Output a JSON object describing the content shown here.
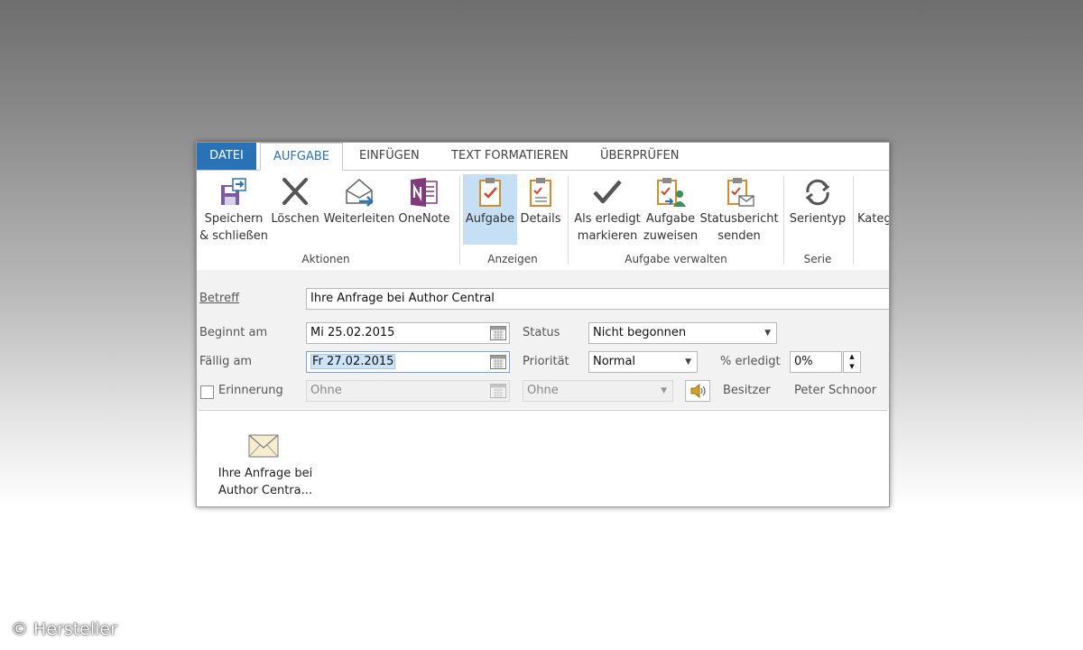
{
  "tabs": [
    {
      "label": "DATEI"
    },
    {
      "label": "AUFGABE"
    },
    {
      "label": "EINFÜGEN"
    },
    {
      "label": "TEXT FORMATIEREN"
    },
    {
      "label": "ÜBERPRÜFEN"
    }
  ],
  "ribbon": {
    "buttons": {
      "save_close": {
        "line1": "Speichern",
        "line2": "& schließen",
        "icon": "save-close-icon"
      },
      "delete": {
        "line1": "Löschen",
        "icon": "delete-x-icon"
      },
      "forward": {
        "line1": "Weiterleiten",
        "icon": "forward-mail-icon"
      },
      "onenote": {
        "line1": "OneNote",
        "icon": "onenote-icon"
      },
      "task": {
        "line1": "Aufgabe",
        "icon": "task-clipboard-icon"
      },
      "details": {
        "line1": "Details",
        "icon": "details-clipboard-icon"
      },
      "mark_done": {
        "line1": "Als erledigt",
        "line2": "markieren",
        "icon": "checkmark-icon"
      },
      "assign": {
        "line1": "Aufgabe",
        "line2": "zuweisen",
        "icon": "assign-task-icon"
      },
      "status_report": {
        "line1": "Statusbericht",
        "line2": "senden",
        "icon": "status-report-icon"
      },
      "recurrence": {
        "line1": "Serientyp",
        "icon": "recurrence-icon"
      },
      "categorize": {
        "line1": "Kateg"
      }
    },
    "groups": {
      "actions": "Aktionen",
      "show": "Anzeigen",
      "manage": "Aufgabe verwalten",
      "series": "Serie"
    }
  },
  "form": {
    "subject_label": "Betreff",
    "subject_value": "Ihre Anfrage bei Author Central",
    "start_label": "Beginnt am",
    "start_value": "Mi 25.02.2015",
    "due_label": "Fällig am",
    "due_value": "Fr 27.02.2015",
    "reminder_label": "Erinnerung",
    "reminder_checked": false,
    "reminder_date": "Ohne",
    "reminder_time": "Ohne",
    "status_label": "Status",
    "status_value": "Nicht begonnen",
    "priority_label": "Priorität",
    "priority_value": "Normal",
    "percent_label": "% erledigt",
    "percent_value": "0%",
    "owner_label": "Besitzer",
    "owner_value": "Peter Schnoor"
  },
  "attachment": {
    "line1": "Ihre Anfrage bei",
    "line2": "Author Centra...",
    "icon": "envelope-icon"
  },
  "watermark": "© Hersteller",
  "colors": {
    "file_tab": "#2a72b8",
    "selected_button": "#c5dff5",
    "onenote_purple": "#80397b"
  }
}
